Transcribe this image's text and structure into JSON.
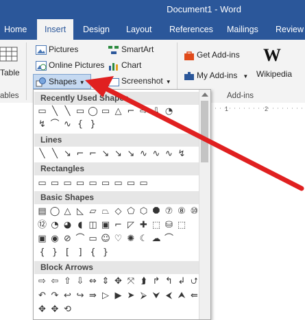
{
  "title": "Document1  -  Word",
  "tabs": [
    "Home",
    "Insert",
    "Design",
    "Layout",
    "References",
    "Mailings",
    "Review"
  ],
  "ribbon": {
    "table_label": "Table",
    "tables_group": "ables",
    "pictures": "Pictures",
    "online_pictures": "Online Pictures",
    "shapes": "Shapes",
    "smartart": "SmartArt",
    "chart": "Chart",
    "screenshot": "Screenshot",
    "get_addins": "Get Add-ins",
    "my_addins": "My Add-ins",
    "wikipedia": "Wikipedia",
    "wiki_logo": "W",
    "addins_group": "Add-ins"
  },
  "shapes_menu": {
    "sections": [
      "Recently Used Shapes",
      "Lines",
      "Rectangles",
      "Basic Shapes",
      "Block Arrows"
    ],
    "recent_glyphs": [
      "▭",
      "╲",
      "╲",
      "▭",
      "◯",
      "▭",
      "△",
      "⌐",
      "⇨",
      "⇩",
      "◔"
    ],
    "recent_glyphs2": [
      "↯",
      "⌒",
      "∿",
      "{",
      "}"
    ],
    "lines_glyphs": [
      "╲",
      "╲",
      "↘",
      "⌐",
      "⌐",
      "↘",
      "↘",
      "↘",
      "∿",
      "∿",
      "∿",
      "↯"
    ],
    "rect_glyphs": [
      "▭",
      "▭",
      "▭",
      "▭",
      "▭",
      "▭",
      "▭",
      "▭",
      "▭"
    ],
    "basic_row1": [
      "▤",
      "◯",
      "△",
      "◺",
      "▱",
      "⏢",
      "◇",
      "⬠",
      "⬡",
      "⯃",
      "⑦",
      "⑧",
      "⑩"
    ],
    "basic_row2": [
      "⑫",
      "◔",
      "◕",
      "◖",
      "◫",
      "▣",
      "⌐",
      "◸",
      "✚",
      "⬚",
      "⛁",
      "⬚"
    ],
    "basic_row3": [
      "▣",
      "◉",
      "⊘",
      "⌒",
      "▭",
      "☺",
      "♡",
      "✺",
      "☾",
      "☁",
      "⌒"
    ],
    "basic_row4": [
      "{",
      "}",
      "[",
      "]",
      "{",
      "}"
    ],
    "arrow_row1": [
      "⇨",
      "⇦",
      "⇧",
      "⇩",
      "⇔",
      "⇕",
      "✥",
      "⤧",
      "⮭",
      "↱",
      "↰",
      "↲",
      "⮍"
    ],
    "arrow_row2": [
      "↶",
      "↷",
      "↩",
      "↪",
      "⇛",
      "▷",
      "▶",
      "➤",
      "⮚",
      "⮟",
      "⮜",
      "⮝",
      "⇚"
    ],
    "arrow_row3": [
      "✥",
      "✥",
      "⟲"
    ]
  },
  "colors": {
    "accent": "#2b579a",
    "arrow": "#e02020"
  }
}
